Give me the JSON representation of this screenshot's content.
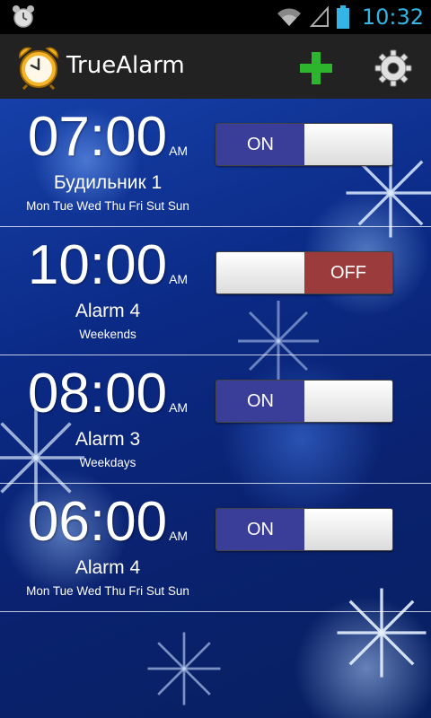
{
  "status_bar": {
    "time": "10:32",
    "icons": [
      "alarm-clock-icon",
      "wifi-icon",
      "signal-icon",
      "battery-icon"
    ]
  },
  "app": {
    "title": "TrueAlarm",
    "icon": "alarm-clock-icon"
  },
  "actions": {
    "add_icon": "plus-icon",
    "settings_icon": "gear-icon"
  },
  "alarms": [
    {
      "time": "07:00",
      "ampm": "AM",
      "name": "Будильник 1",
      "days": "Mon Tue Wed Thu Fri Sut Sun",
      "state": "ON"
    },
    {
      "time": "10:00",
      "ampm": "AM",
      "name": "Alarm 4",
      "days": "Weekends",
      "state": "OFF"
    },
    {
      "time": "08:00",
      "ampm": "AM",
      "name": "Alarm 3",
      "days": "Weekdays",
      "state": "ON"
    },
    {
      "time": "06:00",
      "ampm": "AM",
      "name": "Alarm 4",
      "days": "Mon Tue Wed Thu Fri Sut Sun",
      "state": "ON"
    }
  ],
  "colors": {
    "status_accent": "#33b5e5",
    "toggle_on": "#3b3e98",
    "toggle_off": "#9b3b3b",
    "add_green": "#2db52d"
  }
}
